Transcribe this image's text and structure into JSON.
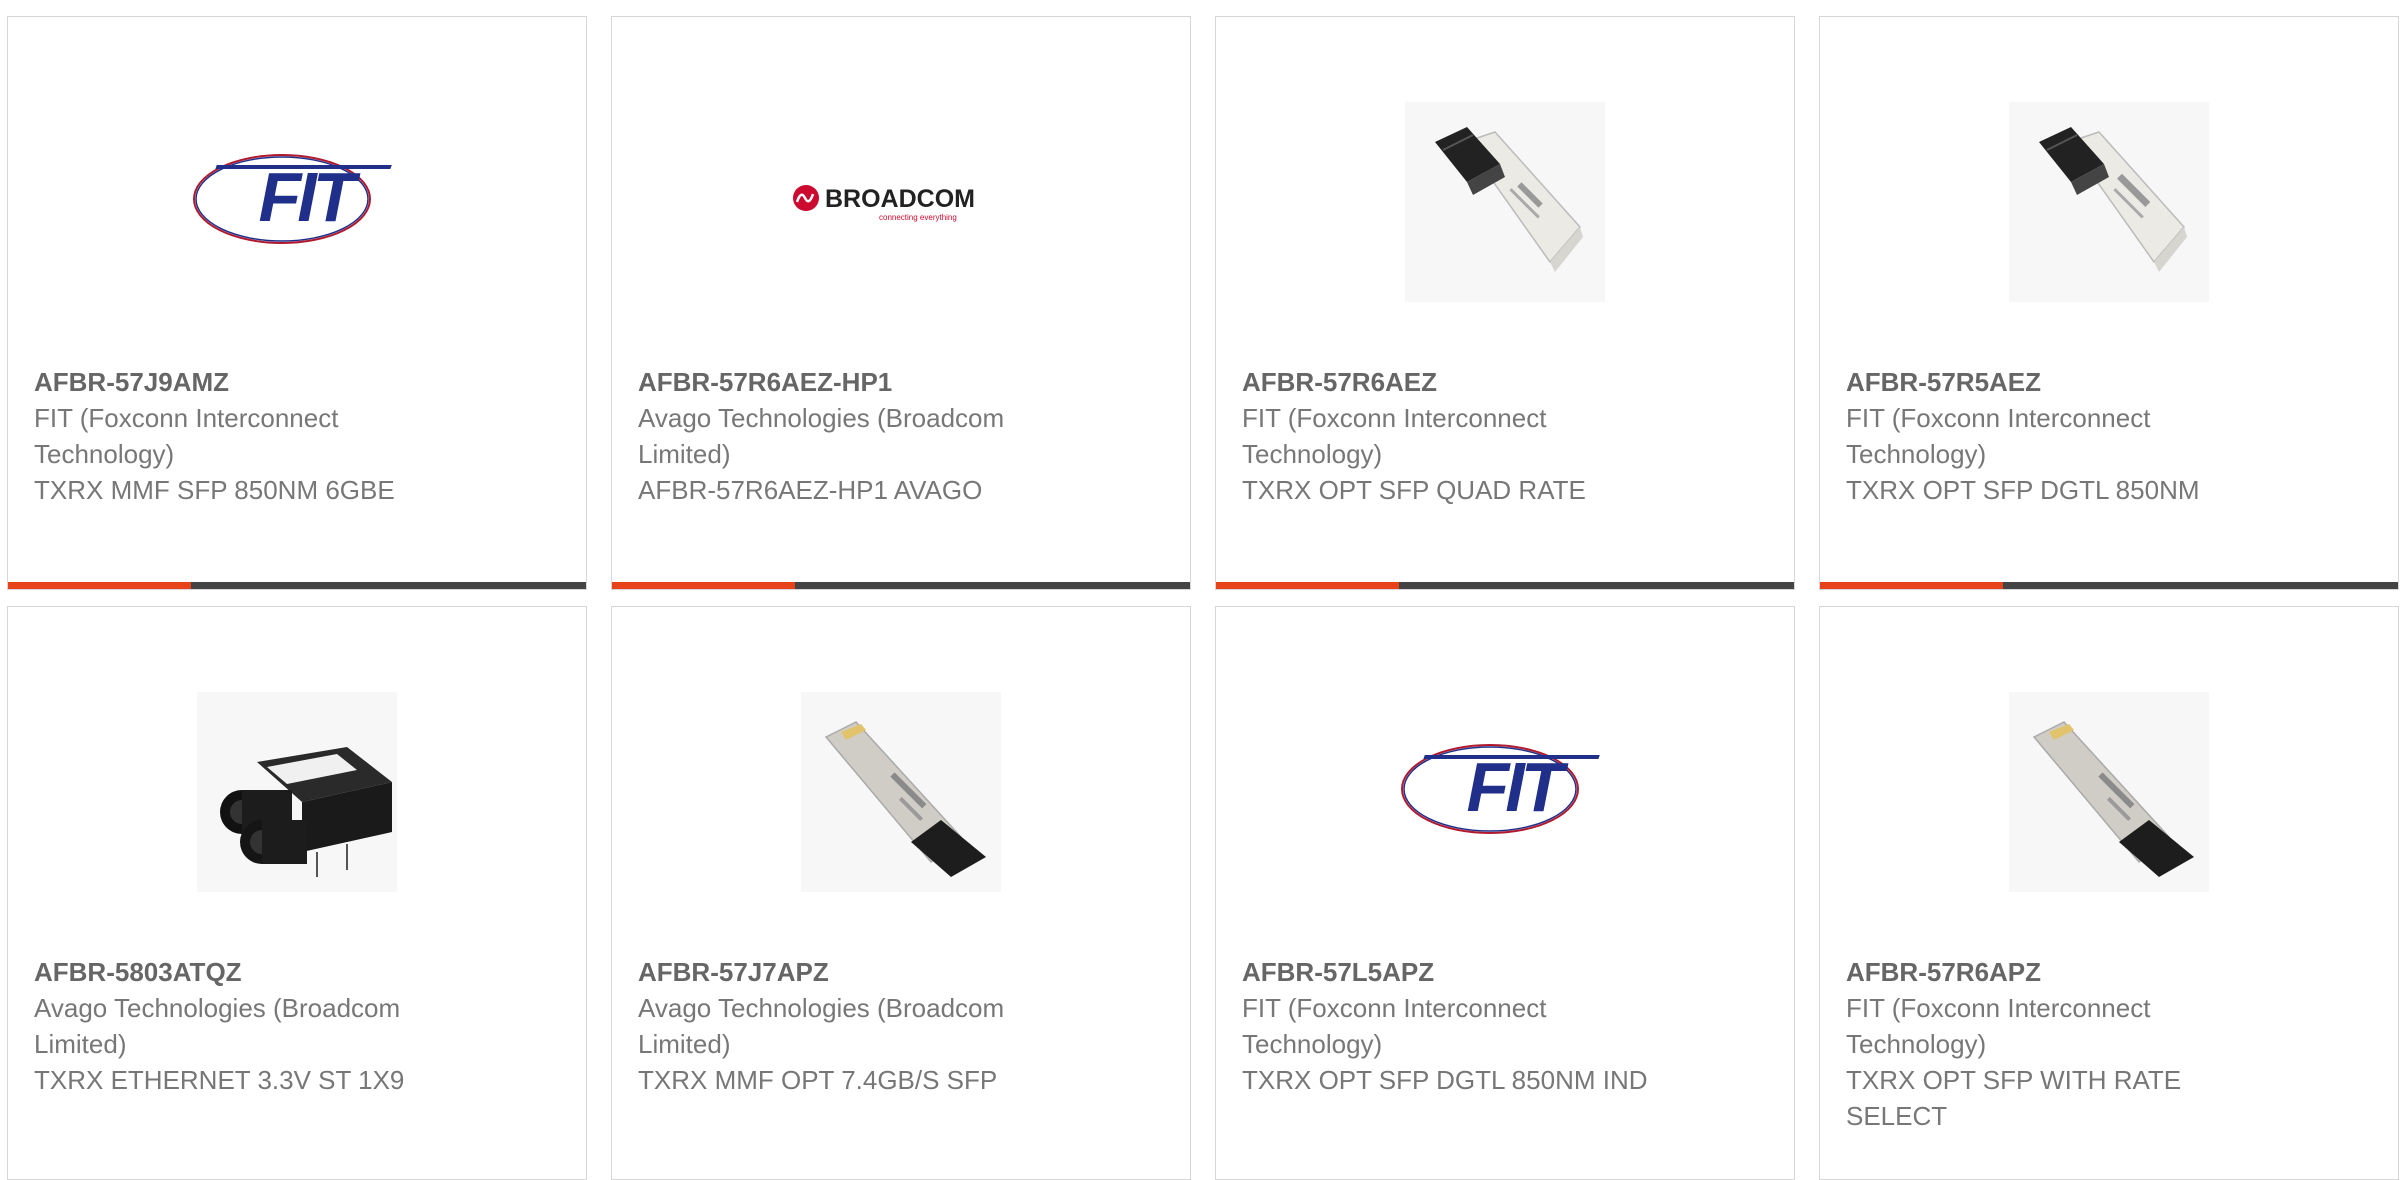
{
  "colors": {
    "accent": "#e8421a",
    "bar_track": "#444444",
    "border": "#d6d6d6",
    "text": "#777777",
    "fit_blue": "#1f2f8a",
    "broadcom_red": "#cc092f"
  },
  "products": [
    {
      "part_number": "AFBR-57J9AMZ",
      "manufacturer": "FIT (Foxconn Interconnect Technology)",
      "description": "TXRX MMF SFP 850NM 6GBE",
      "image": "fit-logo",
      "progress": 0.316
    },
    {
      "part_number": "AFBR-57R6AEZ-HP1",
      "manufacturer": "Avago Technologies (Broadcom Limited)",
      "description": "AFBR-57R6AEZ-HP1 AVAGO",
      "image": "broadcom-logo",
      "logo_text": "BROADCOM",
      "logo_tagline": "connecting everything",
      "progress": 0.316
    },
    {
      "part_number": "AFBR-57R6AEZ",
      "manufacturer": "FIT (Foxconn Interconnect Technology)",
      "description": "TXRX OPT SFP QUAD RATE",
      "image": "sfp-module-white",
      "progress": 0.316
    },
    {
      "part_number": "AFBR-57R5AEZ",
      "manufacturer": "FIT (Foxconn Interconnect Technology)",
      "description": "TXRX OPT SFP DGTL 850NM",
      "image": "sfp-module-white",
      "progress": 0.316
    },
    {
      "part_number": "AFBR-5803ATQZ",
      "manufacturer": "Avago Technologies (Broadcom Limited)",
      "description": "TXRX ETHERNET 3.3V ST 1X9",
      "image": "st-transceiver-black"
    },
    {
      "part_number": "AFBR-57J7APZ",
      "manufacturer": "Avago Technologies (Broadcom Limited)",
      "description": "TXRX MMF OPT 7.4GB/S SFP",
      "image": "sfp-module-silver"
    },
    {
      "part_number": "AFBR-57L5APZ",
      "manufacturer": "FIT (Foxconn Interconnect Technology)",
      "description": "TXRX OPT SFP DGTL 850NM IND",
      "image": "fit-logo"
    },
    {
      "part_number": "AFBR-57R6APZ",
      "manufacturer": "FIT (Foxconn Interconnect Technology)",
      "description": "TXRX OPT SFP WITH RATE SELECT",
      "image": "sfp-module-silver"
    }
  ]
}
